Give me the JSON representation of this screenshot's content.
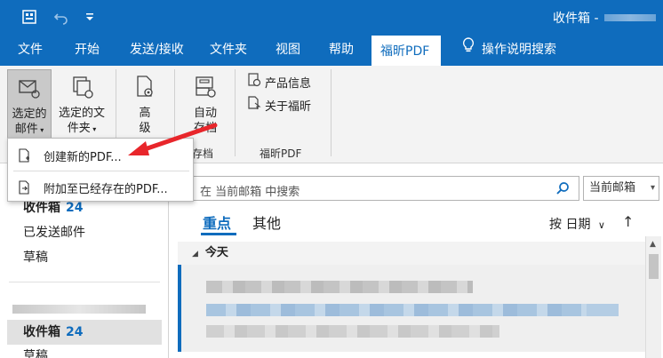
{
  "window": {
    "title": "收件箱 -"
  },
  "menu": {
    "tabs": [
      {
        "label": "文件"
      },
      {
        "label": "开始"
      },
      {
        "label": "发送/接收"
      },
      {
        "label": "文件夹"
      },
      {
        "label": "视图"
      },
      {
        "label": "帮助"
      },
      {
        "label": "福昕PDF",
        "active": true
      },
      {
        "label": "操作说明搜索"
      }
    ]
  },
  "ribbon": {
    "selected_mail": "选定的\n邮件",
    "selected_folder": "选定的文\n件夹",
    "advanced": "高\n级",
    "auto_archive": "自动\n存档",
    "archive_group_label": "存档",
    "product_info": "产品信息",
    "about": "关于福昕",
    "foxit_group_label": "福昕PDF"
  },
  "dropdown": {
    "items": [
      {
        "label": "创建新的PDF..."
      },
      {
        "label": "附加至已经存在的PDF..."
      }
    ]
  },
  "folders": {
    "favorites": [
      {
        "label": "收件箱",
        "count": "24"
      },
      {
        "label": "已发送邮件"
      },
      {
        "label": "草稿"
      }
    ],
    "account": [
      {
        "label": "收件箱",
        "count": "24"
      },
      {
        "label": "草稿"
      }
    ]
  },
  "search": {
    "placeholder": "在 当前邮箱 中搜索",
    "scope": "当前邮箱"
  },
  "list": {
    "tabs": [
      "重点",
      "其他"
    ],
    "sort_label": "按 日期",
    "group_today": "今天"
  },
  "colors": {
    "accent": "#0f6cbd",
    "annotation": "#e8262b"
  }
}
